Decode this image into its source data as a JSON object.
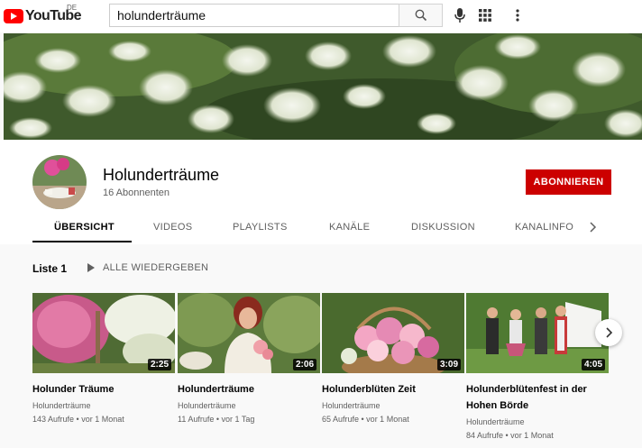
{
  "logo": {
    "text": "YouTube",
    "country": "DE"
  },
  "search": {
    "value": "holunderträume"
  },
  "channel": {
    "title": "Holunderträume",
    "subscribers": "16 Abonnenten",
    "subscribe_label": "ABONNIEREN"
  },
  "tabs": [
    "ÜBERSICHT",
    "VIDEOS",
    "PLAYLISTS",
    "KANÄLE",
    "DISKUSSION",
    "KANALINFO"
  ],
  "section": {
    "title": "Liste 1",
    "play_all": "ALLE WIEDERGEBEN"
  },
  "videos": [
    {
      "title": "Holunder Träume",
      "channel": "Holunderträume",
      "meta": "143 Aufrufe • vor 1 Monat",
      "duration": "2:25"
    },
    {
      "title": "Holunderträume",
      "channel": "Holunderträume",
      "meta": "11 Aufrufe • vor 1 Tag",
      "duration": "2:06"
    },
    {
      "title": "Holunderblüten Zeit",
      "channel": "Holunderträume",
      "meta": "65 Aufrufe • vor 1 Monat",
      "duration": "3:09"
    },
    {
      "title": "Holunderblütenfest in der Hohen Börde",
      "channel": "Holunderträume",
      "meta": "84 Aufrufe • vor 1 Monat",
      "duration": "4:05"
    }
  ],
  "colors": {
    "brand": "#ff0000",
    "subscribe": "#cc0000"
  }
}
